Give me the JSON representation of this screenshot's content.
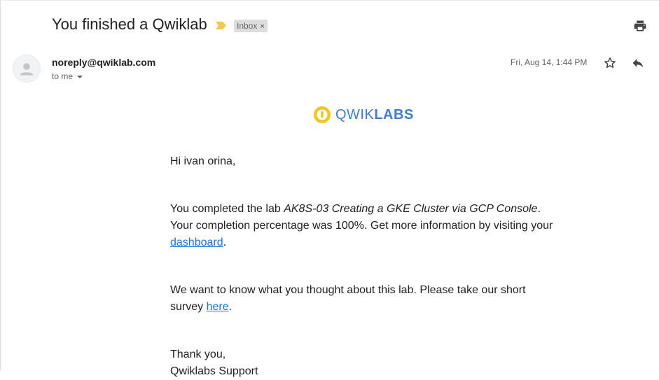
{
  "email": {
    "subject": "You finished a Qwiklab",
    "label_chip": "Inbox",
    "label_remove": "×",
    "sender": "noreply@qwiklab.com",
    "recipient": "to me",
    "date": "Fri, Aug 14, 1:44 PM"
  },
  "icons": {
    "importance": "importance-marker-icon",
    "print": "print-icon",
    "avatar": "person-icon",
    "star": "star-icon",
    "reply": "reply-icon",
    "logo_mark": "qwiklabs-logo-icon"
  },
  "logo": {
    "light": "QWIK",
    "bold": "LABS"
  },
  "body": {
    "greeting": "Hi ivan orina,",
    "main_prefix": "You completed the lab ",
    "lab_name": "AK8S-03 Creating a GKE Cluster via GCP Console",
    "main_suffix": ". Your completion percentage was 100%. Get more information by visiting your ",
    "dashboard_link": "dashboard",
    "main_end": ".",
    "survey_prefix": "We want to know what you thought about this lab. Please take our short survey ",
    "survey_link": "here",
    "survey_end": ".",
    "thanks": "Thank you,",
    "signature": "Qwiklabs Support"
  },
  "colors": {
    "link": "#1a73e8",
    "logo_blue": "#3b7dd8",
    "logo_yellow": "#f5c518",
    "importance_yellow": "#f2c94c"
  }
}
